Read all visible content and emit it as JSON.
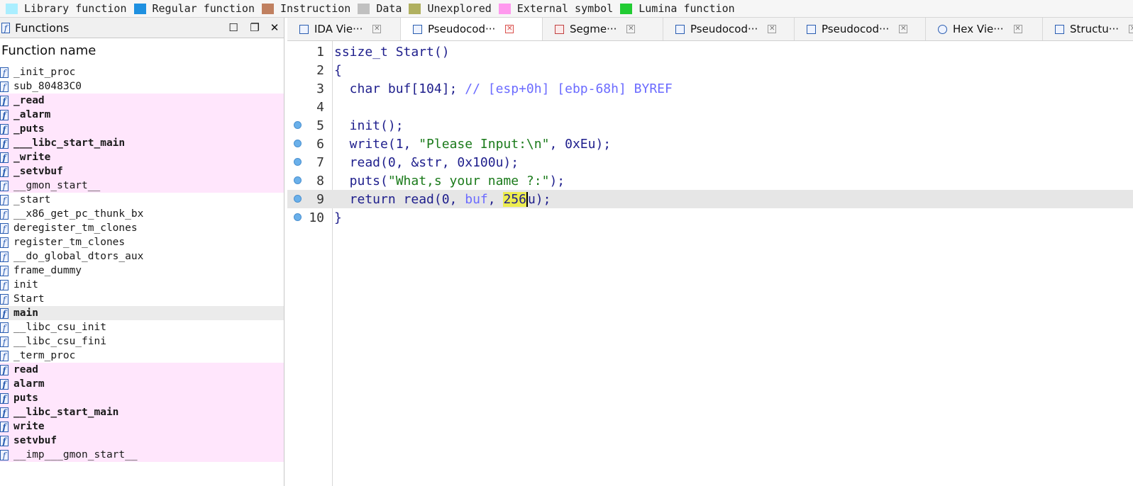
{
  "legend": [
    {
      "label": "Library function",
      "color": "#aaeeff"
    },
    {
      "label": "Regular function",
      "color": "#1e90e0"
    },
    {
      "label": "Instruction",
      "color": "#c08060"
    },
    {
      "label": "Data",
      "color": "#c0c0c0"
    },
    {
      "label": "Unexplored",
      "color": "#b0b060"
    },
    {
      "label": "External symbol",
      "color": "#ff99ee"
    },
    {
      "label": "Lumina function",
      "color": "#22cc33"
    }
  ],
  "functions_panel": {
    "title": "Functions",
    "column_header": "Function name",
    "items": [
      {
        "name": "_init_proc",
        "style": "normal"
      },
      {
        "name": "sub_80483C0",
        "style": "normal"
      },
      {
        "name": "_read",
        "style": "pink-bold"
      },
      {
        "name": "_alarm",
        "style": "pink-bold"
      },
      {
        "name": "_puts",
        "style": "pink-bold"
      },
      {
        "name": "___libc_start_main",
        "style": "pink-bold"
      },
      {
        "name": "_write",
        "style": "pink-bold"
      },
      {
        "name": "_setvbuf",
        "style": "pink-bold"
      },
      {
        "name": "__gmon_start__",
        "style": "pink"
      },
      {
        "name": "_start",
        "style": "normal"
      },
      {
        "name": "__x86_get_pc_thunk_bx",
        "style": "normal"
      },
      {
        "name": "deregister_tm_clones",
        "style": "normal"
      },
      {
        "name": "register_tm_clones",
        "style": "normal"
      },
      {
        "name": "__do_global_dtors_aux",
        "style": "normal"
      },
      {
        "name": "frame_dummy",
        "style": "normal"
      },
      {
        "name": "init",
        "style": "normal"
      },
      {
        "name": "Start",
        "style": "normal"
      },
      {
        "name": "main",
        "style": "selected-bold"
      },
      {
        "name": "__libc_csu_init",
        "style": "normal"
      },
      {
        "name": "__libc_csu_fini",
        "style": "normal"
      },
      {
        "name": "_term_proc",
        "style": "normal"
      },
      {
        "name": "read",
        "style": "pink-bold"
      },
      {
        "name": "alarm",
        "style": "pink-bold"
      },
      {
        "name": "puts",
        "style": "pink-bold"
      },
      {
        "name": "__libc_start_main",
        "style": "pink-bold"
      },
      {
        "name": "write",
        "style": "pink-bold"
      },
      {
        "name": "setvbuf",
        "style": "pink-bold"
      },
      {
        "name": "__imp___gmon_start__",
        "style": "pink"
      }
    ]
  },
  "tabs": [
    {
      "label": "IDA Vie···",
      "icon": "ida-view-icon",
      "active": false
    },
    {
      "label": "Pseudocod···",
      "icon": "pseudocode-icon",
      "active": true
    },
    {
      "label": "Segme···",
      "icon": "segments-icon",
      "active": false
    },
    {
      "label": "Pseudocod···",
      "icon": "pseudocode-icon",
      "active": false
    },
    {
      "label": "Pseudocod···",
      "icon": "pseudocode-icon",
      "active": false
    },
    {
      "label": "Hex Vie···",
      "icon": "hex-view-icon",
      "active": false
    },
    {
      "label": "Structu···",
      "icon": "structures-icon",
      "active": false
    }
  ],
  "code": {
    "lines": [
      {
        "no": "1",
        "text": "ssize_t Start()"
      },
      {
        "no": "2",
        "text": "{"
      },
      {
        "no": "3",
        "text": "  char buf[104]; // [esp+0h] [ebp-68h] BYREF"
      },
      {
        "no": "4",
        "text": ""
      },
      {
        "no": "5",
        "text": "  init();"
      },
      {
        "no": "6",
        "text": "  write(1, \"Please Input:\\n\", 0xEu);"
      },
      {
        "no": "7",
        "text": "  read(0, &str, 0x100u);"
      },
      {
        "no": "8",
        "text": "  puts(\"What,s your name ?:\");"
      },
      {
        "no": "9",
        "text": "  return read(0, buf, 256u);"
      },
      {
        "no": "10",
        "text": "}"
      }
    ]
  }
}
